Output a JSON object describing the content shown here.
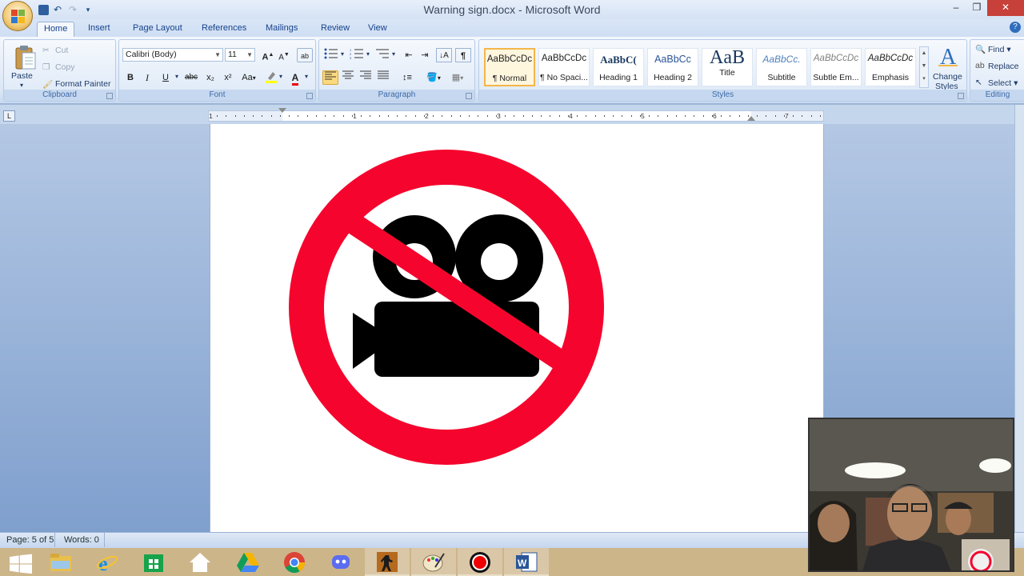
{
  "window": {
    "title": "Warning sign.docx - Microsoft Word"
  },
  "qat": {
    "undo_icon": "↶",
    "redo_icon": "↷",
    "more_icon": "▾"
  },
  "tabs": [
    "Home",
    "Insert",
    "Page Layout",
    "References",
    "Mailings",
    "Review",
    "View"
  ],
  "clipboard": {
    "paste": "Paste",
    "cut": "Cut",
    "copy": "Copy",
    "format_painter": "Format Painter",
    "label": "Clipboard"
  },
  "font": {
    "name": "Calibri (Body)",
    "size": "11",
    "label": "Font",
    "bold": "B",
    "italic": "I",
    "underline": "U",
    "strike": "abc",
    "subscript": "x₂",
    "superscript": "x²",
    "case": "Aa",
    "grow": "A",
    "shrink": "A"
  },
  "paragraph": {
    "label": "Paragraph",
    "pilcrow": "¶"
  },
  "styles": {
    "label": "Styles",
    "items": [
      {
        "sample": "AaBbCcDc",
        "name": "¶ Normal"
      },
      {
        "sample": "AaBbCcDc",
        "name": "¶ No Spaci..."
      },
      {
        "sample": "AaBbC(",
        "name": "Heading 1"
      },
      {
        "sample": "AaBbCc",
        "name": "Heading 2"
      },
      {
        "sample": "AaB",
        "name": "Title"
      },
      {
        "sample": "AaBbCc.",
        "name": "Subtitle"
      },
      {
        "sample": "AaBbCcDc",
        "name": "Subtle Em..."
      },
      {
        "sample": "AaBbCcDc",
        "name": "Emphasis"
      }
    ],
    "change_styles_1": "Change",
    "change_styles_2": "Styles"
  },
  "editing": {
    "find": "Find",
    "replace": "Replace",
    "select": "Select",
    "label": "Editing"
  },
  "ruler": {
    "numbers": [
      "1",
      "1",
      "2",
      "3",
      "4",
      "5",
      "6",
      "7"
    ]
  },
  "status": {
    "page": "Page: 5 of 5",
    "words": "Words: 0"
  },
  "colors": {
    "sign_red": "#f5052d",
    "camera_black": "#000000",
    "selected_style": "#f3b64a",
    "taskbar": "#cdb58a"
  }
}
